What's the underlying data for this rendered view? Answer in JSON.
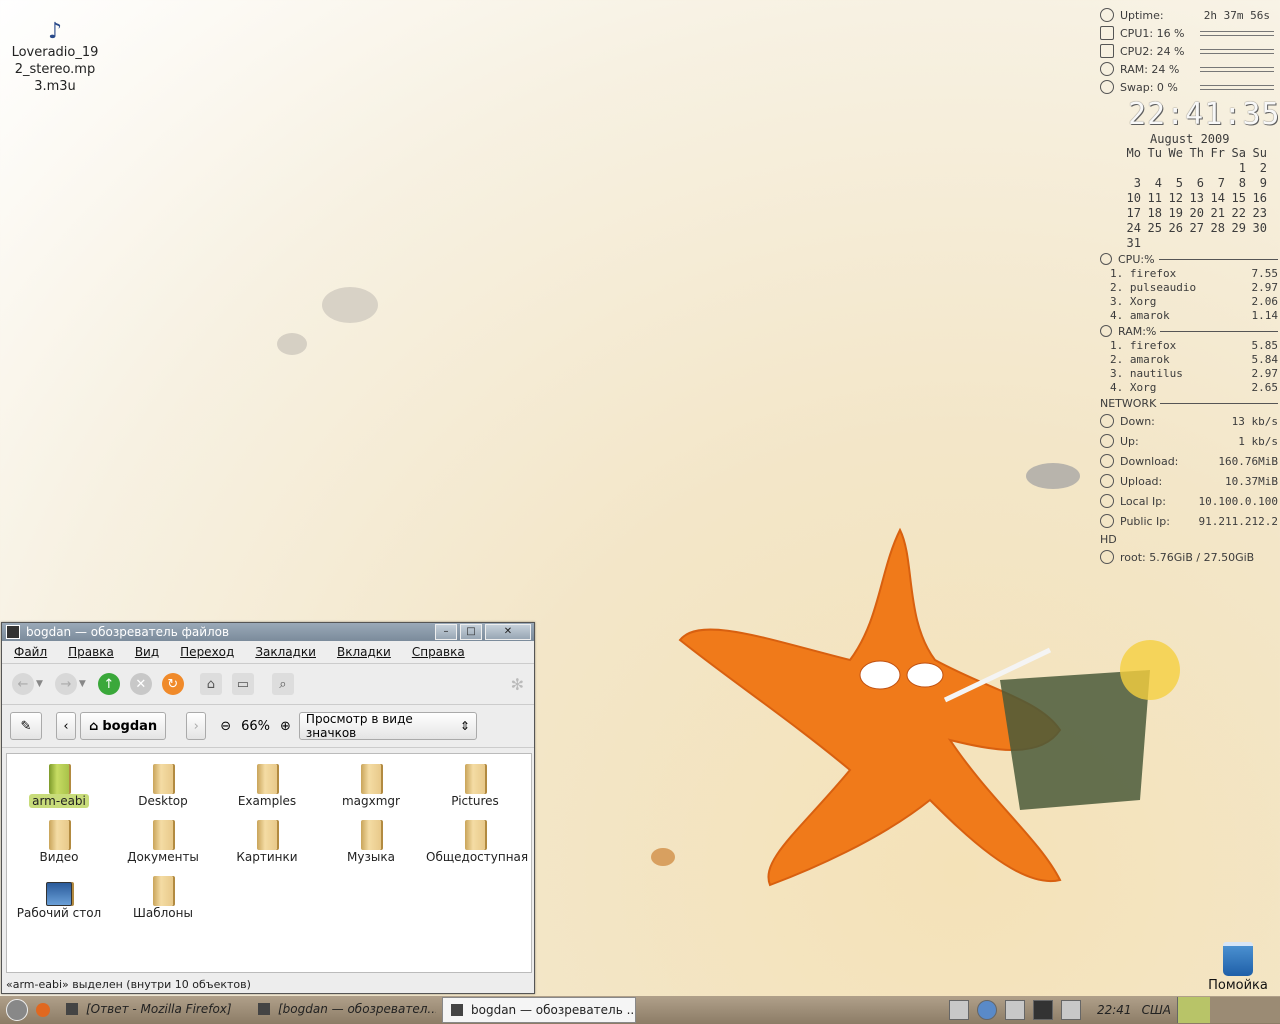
{
  "desktop": {
    "file_icon": "music-note-icon",
    "file_label": "Loveradio_192_stereo.mp3.m3u",
    "trash_label": "Помойка"
  },
  "conky": {
    "system": [
      {
        "label": "Uptime:",
        "value": "2h 37m 56s",
        "icon": "sun-icon"
      },
      {
        "label": "CPU1: 16 %",
        "bar": 0.16,
        "icon": "cpu-icon"
      },
      {
        "label": "CPU2: 24 %",
        "bar": 0.24,
        "icon": "cpu-icon"
      },
      {
        "label": "RAM: 24 %",
        "bar": 0.24,
        "icon": "ram-icon"
      },
      {
        "label": "Swap: 0  %",
        "bar": 0.0,
        "icon": "swap-icon"
      }
    ],
    "time": "22:41:35",
    "calendar": {
      "title": "August  2009",
      "days": [
        "Mo",
        "Tu",
        "We",
        "Th",
        "Fr",
        "Sa",
        "Su"
      ],
      "cells": [
        "",
        "",
        "",
        "",
        "",
        "1",
        "2",
        "3",
        "4",
        "5",
        "6",
        "7",
        "8",
        "9",
        "10",
        "11",
        "12",
        "13",
        "14",
        "15",
        "16",
        "17",
        "18",
        "19",
        "20",
        "21",
        "22",
        "23",
        "24",
        "25",
        "26",
        "27",
        "28",
        "29",
        "30",
        "31",
        "",
        "",
        "",
        "",
        "",
        ""
      ]
    },
    "cpu_head": "CPU:%",
    "cpu_top": [
      {
        "name": "1. firefox",
        "val": "7.55"
      },
      {
        "name": "2. pulseaudio",
        "val": "2.97"
      },
      {
        "name": "3. Xorg",
        "val": "2.06"
      },
      {
        "name": "4. amarok",
        "val": "1.14"
      }
    ],
    "ram_head": "RAM:%",
    "ram_top": [
      {
        "name": "1. firefox",
        "val": "5.85"
      },
      {
        "name": "2. amarok",
        "val": "5.84"
      },
      {
        "name": "3. nautilus",
        "val": "2.97"
      },
      {
        "name": "4. Xorg",
        "val": "2.65"
      }
    ],
    "network_head": "NETWORK",
    "net": [
      {
        "k": "Down:",
        "v": "13   kb/s"
      },
      {
        "k": "Up:",
        "v": "1   kb/s"
      },
      {
        "k": "Download:",
        "v": "160.76MiB"
      },
      {
        "k": "Upload:",
        "v": "10.37MiB"
      },
      {
        "k": "Local Ip:",
        "v": "10.100.0.100"
      },
      {
        "k": "Public Ip:",
        "v": "91.211.212.2"
      }
    ],
    "hd_head": "HD",
    "hd_row": "root:  5.76GiB  / 27.50GiB"
  },
  "window": {
    "title": "bogdan — обозреватель файлов",
    "menu": [
      "Файл",
      "Правка",
      "Вид",
      "Переход",
      "Закладки",
      "Вкладки",
      "Справка"
    ],
    "location": "bogdan",
    "zoom": "66%",
    "view_mode": "Просмотр в виде значков",
    "items": [
      {
        "name": "arm-eabi",
        "kind": "folder-selected"
      },
      {
        "name": "Desktop",
        "kind": "folder"
      },
      {
        "name": "Examples",
        "kind": "folder-locked"
      },
      {
        "name": "magxmgr",
        "kind": "folder"
      },
      {
        "name": "Pictures",
        "kind": "folder"
      },
      {
        "name": "Видео",
        "kind": "folder"
      },
      {
        "name": "Документы",
        "kind": "folder"
      },
      {
        "name": "Картинки",
        "kind": "folder"
      },
      {
        "name": "Музыка",
        "kind": "folder"
      },
      {
        "name": "Общедоступная",
        "kind": "folder"
      },
      {
        "name": "Рабочий стол",
        "kind": "desktop"
      },
      {
        "name": "Шаблоны",
        "kind": "folder"
      }
    ],
    "status": "«arm-eabi» выделен (внутри 10 объектов)"
  },
  "taskbar": {
    "tasks": [
      {
        "label": "[Ответ - Mozilla Firefox]",
        "active": false
      },
      {
        "label": "[bogdan — обозревател...",
        "active": false
      },
      {
        "label": "bogdan — обозреватель ...",
        "active": true
      }
    ],
    "clock": "22:41",
    "layout": "США"
  }
}
